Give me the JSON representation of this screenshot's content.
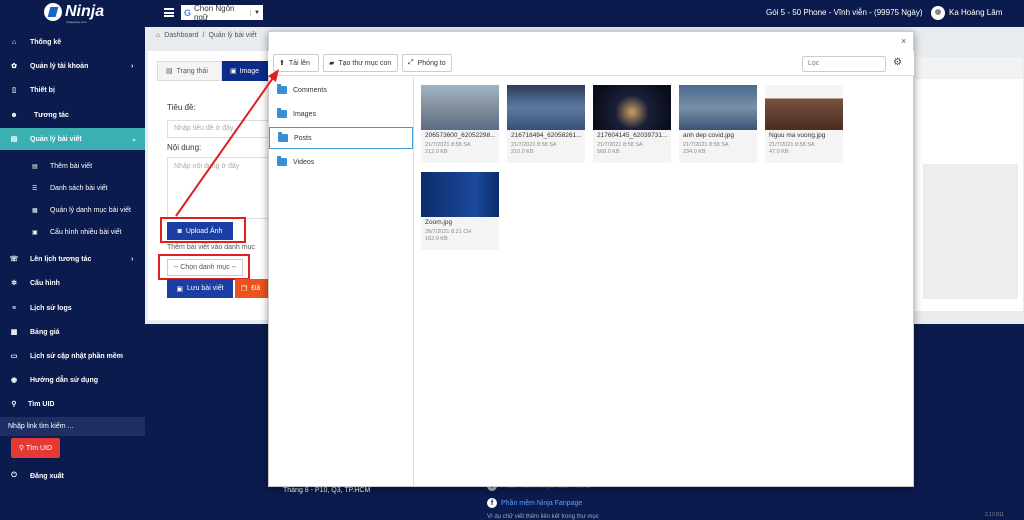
{
  "header": {
    "logo": "Ninja",
    "logo_sub": "ninjagroup.com",
    "language": "Chọn Ngôn ngữ",
    "plan": "Gói 5 - 50 Phone - Vĩnh viễn - (99975 Ngày)",
    "user": "Ka Hoàng Lâm"
  },
  "sidebar": {
    "items": [
      {
        "label": "Thống kê",
        "icon": "home-icon"
      },
      {
        "label": "Quản lý tài khoản",
        "icon": "gear-icon"
      },
      {
        "label": "Thiết bị",
        "icon": "mobile-icon"
      },
      {
        "label": "Tương tác",
        "icon": "users-icon"
      },
      {
        "label": "Quản lý bài viết",
        "icon": "doc-icon"
      },
      {
        "label": "Lên lịch tương tác",
        "icon": "calendar-icon"
      },
      {
        "label": "Cấu hình",
        "icon": "cog-icon"
      },
      {
        "label": "Lịch sử logs",
        "icon": "list-icon"
      },
      {
        "label": "Bảng giá",
        "icon": "table-icon"
      },
      {
        "label": "Lịch sử cập nhật phần mềm",
        "icon": "chat-icon"
      },
      {
        "label": "Hướng dẫn sử dụng",
        "icon": "globe-icon"
      },
      {
        "label": "Tìm UID",
        "icon": "search-icon"
      }
    ],
    "sub_items": [
      "Thêm bài viết",
      "Danh sách bài viết",
      "Quản lý danh mục bài viết",
      "Cấu hình nhiều bài viết"
    ],
    "search_placeholder": "Nhập link tìm kiếm ...",
    "find_button": "Tìm UID",
    "logout": "Đăng xuất"
  },
  "breadcrumb": {
    "home": "Dashboard",
    "sep": "/",
    "current": "Quản lý bài viết"
  },
  "form": {
    "tab_status": "Trạng thái",
    "tab_image": "Image",
    "title_label": "Tiêu đề:",
    "title_placeholder": "Nhập tiêu đề ở đây",
    "content_label": "Nội dung:",
    "content_placeholder": "Nhập nội dung ở đây",
    "upload_button": "Upload Ảnh",
    "category_label": "Thêm bài viết vào danh mục",
    "category_select": "-- Chọn danh mục --",
    "save_button": "Lưu bài viết",
    "orange_button": "Đă"
  },
  "modal": {
    "close": "×",
    "upload": "Tải lên",
    "new_folder": "Tạo thư mục con",
    "zoom": "Phóng to",
    "filter_placeholder": "Lọc",
    "folders": [
      "Comments",
      "Images",
      "Posts",
      "Videos"
    ],
    "files": [
      {
        "name": "206573600_62052298...",
        "date": "21/7/2021 8:58 SA",
        "size": "212.0 KB"
      },
      {
        "name": "216718494_62058261...",
        "date": "21/7/2021 8:58 SA",
        "size": "210.0 KB"
      },
      {
        "name": "217604145_62039731...",
        "date": "21/7/2021 8:58 SA",
        "size": "568.0 KB"
      },
      {
        "name": "anh dep covid.jpg",
        "date": "21/7/2021 8:58 SA",
        "size": "234.0 KB"
      },
      {
        "name": "Nguu ma vuong.jpg",
        "date": "21/7/2021 8:58 SA",
        "size": "47.0 KB"
      },
      {
        "name": "Zoom.jpg",
        "date": "28/7/2021 8:21 CH",
        "size": "162.0 KB"
      }
    ]
  },
  "footer": {
    "address": "Tháng 8 - P10, Q3, TP.HCM",
    "link1": "Phần mềm Ninja Auto Phone",
    "link2": "Phần mềm Ninja Fanpage",
    "link3": "Ví dụ chữ viết thêm liên kết trong thư mục",
    "version": "2.10.811"
  }
}
